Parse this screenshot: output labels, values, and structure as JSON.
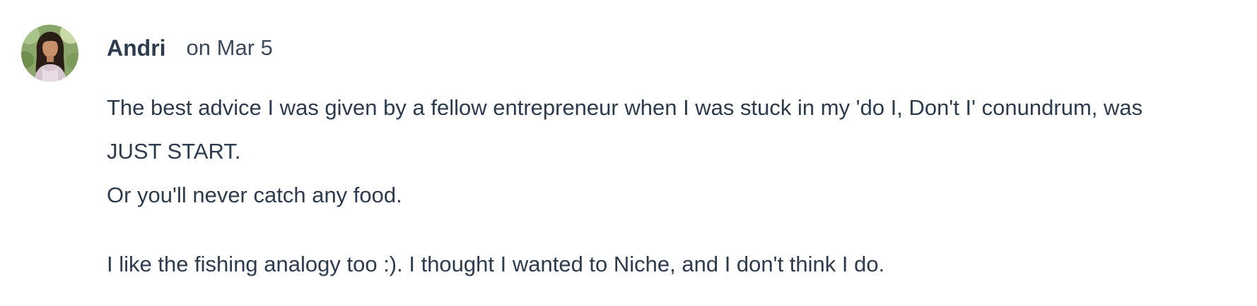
{
  "comment": {
    "author": "Andri",
    "date": "on Mar 5",
    "avatar_icon": "user-avatar-photo",
    "lines": [
      "The best advice I was given by a fellow entrepreneur when I was stuck in my 'do I, Don't I' conundrum, was",
      "JUST START.",
      "Or you'll never catch any food.",
      "I like the fishing analogy too :). I thought I wanted to Niche, and I don't think I do."
    ]
  },
  "colors": {
    "text": "#2d3b4e",
    "date_text": "#3d4a5c",
    "background": "#ffffff"
  }
}
